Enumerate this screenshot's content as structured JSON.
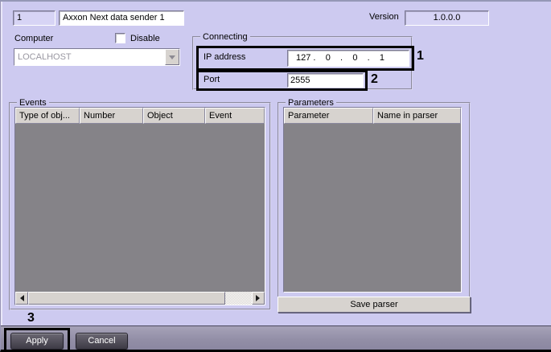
{
  "header": {
    "id_value": "1",
    "name_value": "Axxon Next data sender 1",
    "computer_label": "Computer",
    "disable_label": "Disable",
    "computer_value": "LOCALHOST",
    "version_label": "Version",
    "version_value": "1.0.0.0"
  },
  "connecting": {
    "title": "Connecting",
    "ip_label": "IP address",
    "ip_value": "127 .    0    .    0    .    1",
    "port_label": "Port",
    "port_value": "2555",
    "annotation_1": "1",
    "annotation_2": "2"
  },
  "events": {
    "title": "Events",
    "columns": [
      "Type of obj...",
      "Number",
      "Object",
      "Event"
    ],
    "rows": []
  },
  "parameters": {
    "title": "Parameters",
    "columns": [
      "Parameter",
      "Name in parser"
    ],
    "rows": [],
    "save_button": "Save parser"
  },
  "footer": {
    "annotation_3": "3",
    "apply_label": "Apply",
    "cancel_label": "Cancel"
  },
  "colors": {
    "background": "#CDCAF0",
    "field_tint": "#D7D4F5",
    "button_face": "#D7D3CF",
    "table_body": "#858388",
    "footer_bar": "#928EA6",
    "dark_button": "#3D3A45",
    "annotation": "#000000"
  }
}
